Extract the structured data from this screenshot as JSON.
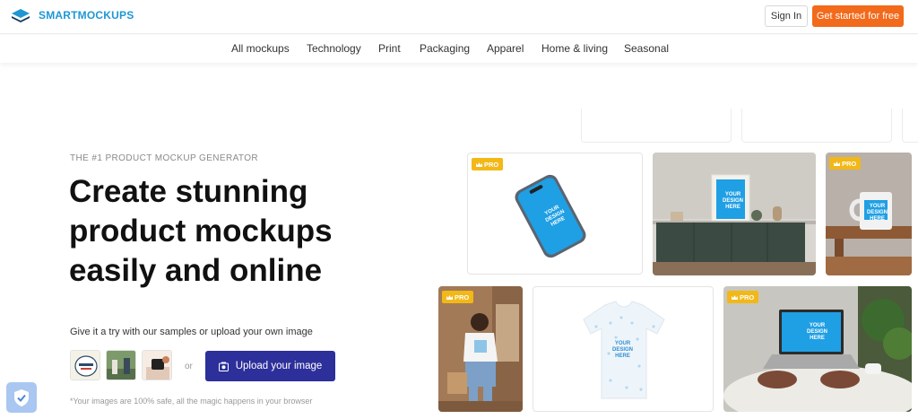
{
  "header": {
    "brand": "SMARTMOCKUPS",
    "sign_in": "Sign In",
    "cta": "Get started for free"
  },
  "nav": {
    "items": [
      {
        "label": "All mockups"
      },
      {
        "label": "Technology"
      },
      {
        "label": "Print"
      },
      {
        "label": "Packaging"
      },
      {
        "label": "Apparel"
      },
      {
        "label": "Home & living"
      },
      {
        "label": "Seasonal"
      }
    ]
  },
  "hero": {
    "eyebrow": "THE #1 PRODUCT MOCKUP GENERATOR",
    "headline": [
      "Create stunning",
      "product mockups",
      "easily and online"
    ],
    "tagline": "Give it a try with our samples or upload your own image",
    "or": "or",
    "upload_label": "Upload your image",
    "disclaimer": "*Your images are 100% safe, all the magic happens in your browser"
  },
  "gallery": {
    "pro_badge": "PRO",
    "design_label": [
      "YOUR",
      "DESIGN",
      "HERE"
    ],
    "tiles": [
      {
        "name": "phone-mockup",
        "pro": true
      },
      {
        "name": "frame-mockup",
        "pro": false
      },
      {
        "name": "mug-mockup",
        "pro": true
      },
      {
        "name": "person-tshirt-mockup",
        "pro": true
      },
      {
        "name": "tshirt-mockup",
        "pro": false
      },
      {
        "name": "laptop-mockup",
        "pro": true
      }
    ]
  },
  "colors": {
    "brand_blue": "#1e97d4",
    "cta_orange": "#f26a1b",
    "upload_navy": "#2d2f9a",
    "pro_gold": "#f2b818"
  },
  "icons": [
    "logo-layers-icon",
    "crown-icon",
    "upload-image-icon",
    "shield-check-icon"
  ]
}
